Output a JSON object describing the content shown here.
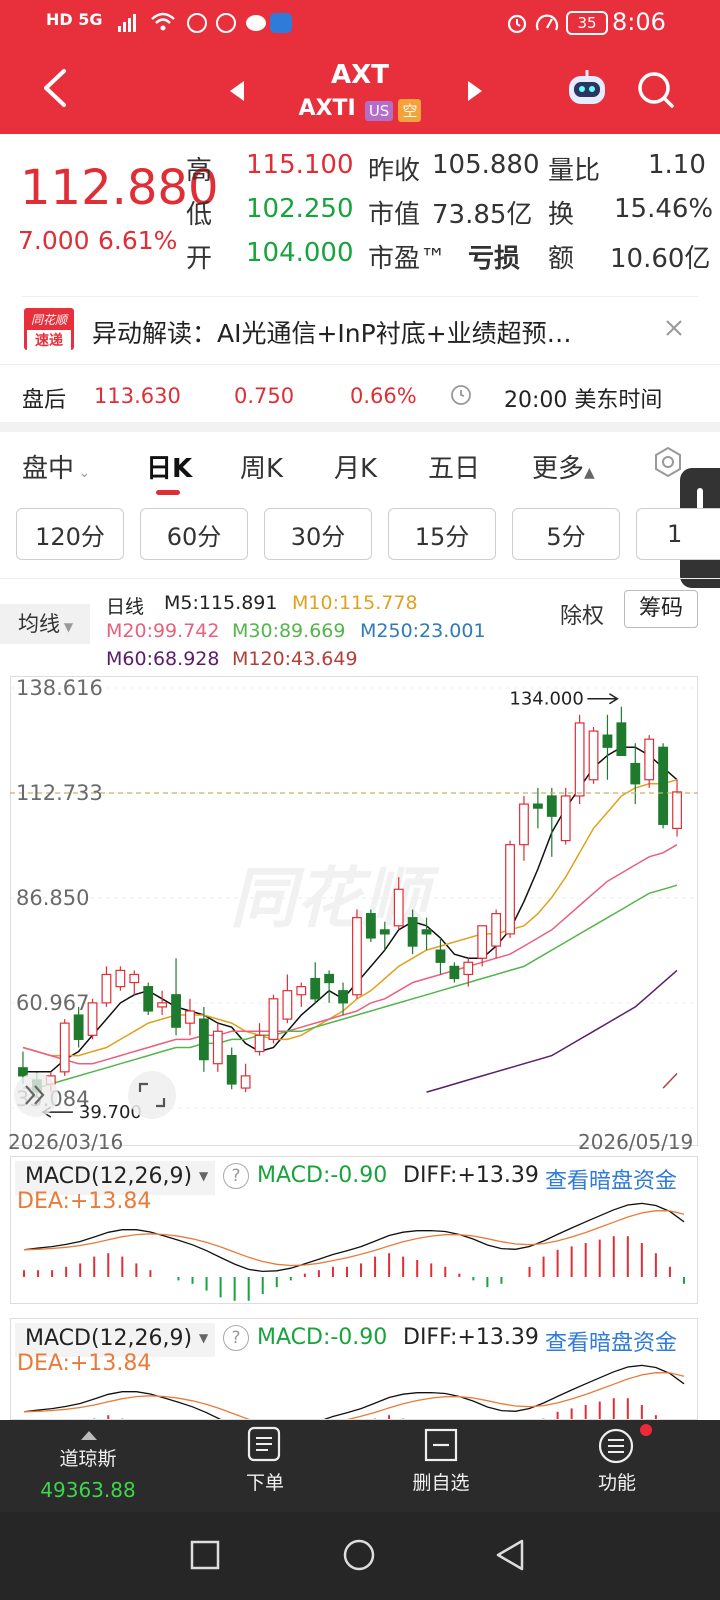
{
  "status_bar": {
    "left_icons": "HD 5G",
    "time": "8:06",
    "battery": "35"
  },
  "header": {
    "ticker": "AXT",
    "symbol": "AXTI",
    "market_badge": "US",
    "short_badge": "空"
  },
  "colors": {
    "up": "#e02e36",
    "down": "#17a43c",
    "brand_red": "#e8303c"
  },
  "quote": {
    "price": "112.880",
    "change": "7.000",
    "change_pct": "6.61%",
    "high_label": "高",
    "high": "115.100",
    "low_label": "低",
    "low": "102.250",
    "open_label": "开",
    "open": "104.000",
    "prev_close_label": "昨收",
    "prev_close": "105.880",
    "mkt_cap_label": "市值",
    "mkt_cap": "73.85亿",
    "pe_label": "市盈™",
    "pe": "亏损",
    "vol_ratio_label": "量比",
    "vol_ratio": "1.10",
    "turnover_label": "换",
    "turnover": "15.46%",
    "amount_label": "额",
    "amount": "10.60亿"
  },
  "news": {
    "logo_top": "同花顺",
    "logo_bottom": "速递",
    "text": "异动解读：AI光通信+InP衬底+业绩超预…"
  },
  "after_hours": {
    "label": "盘后",
    "price": "113.630",
    "change": "0.750",
    "pct": "0.66%",
    "time": "20:00 美东时间"
  },
  "period_tabs": [
    "盘中",
    "日K",
    "周K",
    "月K",
    "五日",
    "更多"
  ],
  "active_tab": "日K",
  "minute_tabs": [
    "120分",
    "60分",
    "30分",
    "15分",
    "5分",
    "1"
  ],
  "ma_legend": {
    "avg_btn": "均线",
    "title": "日线",
    "m5": "M5:115.891",
    "m10": "M10:115.778",
    "m20": "M20:99.742",
    "m30": "M30:89.669",
    "m250": "M250:23.001",
    "m60": "M60:68.928",
    "m120": "M120:43.649",
    "exright": "除权",
    "chips": "筹码"
  },
  "chart_data": {
    "type": "candlestick",
    "y_ticks": [
      "138.616",
      "112.733",
      "86.850",
      "60.967",
      "35.084"
    ],
    "x_start": "2026/03/16",
    "x_end": "2026/05/19",
    "high_annotation": "134.000",
    "low_annotation": "39.700",
    "current_line": 112.733,
    "ylim": [
      35.084,
      138.616
    ],
    "candles": [
      {
        "o": 45,
        "h": 49,
        "l": 41,
        "c": 43
      },
      {
        "o": 42,
        "h": 44,
        "l": 38,
        "c": 39
      },
      {
        "o": 41,
        "h": 44,
        "l": 39,
        "c": 43
      },
      {
        "o": 44,
        "h": 57,
        "l": 43,
        "c": 56
      },
      {
        "o": 58,
        "h": 60,
        "l": 50,
        "c": 52
      },
      {
        "o": 53,
        "h": 62,
        "l": 52,
        "c": 61
      },
      {
        "o": 61,
        "h": 70,
        "l": 60,
        "c": 68
      },
      {
        "o": 65,
        "h": 70,
        "l": 64,
        "c": 69
      },
      {
        "o": 66,
        "h": 69,
        "l": 63,
        "c": 68
      },
      {
        "o": 65,
        "h": 66,
        "l": 58,
        "c": 59
      },
      {
        "o": 60,
        "h": 64,
        "l": 58,
        "c": 61
      },
      {
        "o": 63,
        "h": 72,
        "l": 53,
        "c": 55
      },
      {
        "o": 56,
        "h": 62,
        "l": 53,
        "c": 59
      },
      {
        "o": 57,
        "h": 60,
        "l": 44,
        "c": 47
      },
      {
        "o": 46,
        "h": 56,
        "l": 44,
        "c": 54
      },
      {
        "o": 48,
        "h": 50,
        "l": 39.7,
        "c": 41
      },
      {
        "o": 40,
        "h": 46,
        "l": 39,
        "c": 43
      },
      {
        "o": 49,
        "h": 56,
        "l": 48,
        "c": 53
      },
      {
        "o": 52,
        "h": 63,
        "l": 51,
        "c": 62
      },
      {
        "o": 57,
        "h": 68,
        "l": 56,
        "c": 64
      },
      {
        "o": 63,
        "h": 66,
        "l": 60,
        "c": 65
      },
      {
        "o": 67,
        "h": 71,
        "l": 61,
        "c": 62
      },
      {
        "o": 68,
        "h": 69,
        "l": 61,
        "c": 66
      },
      {
        "o": 64,
        "h": 66,
        "l": 58,
        "c": 61
      },
      {
        "o": 63,
        "h": 84,
        "l": 62,
        "c": 82
      },
      {
        "o": 83,
        "h": 84,
        "l": 76,
        "c": 77
      },
      {
        "o": 79,
        "h": 81,
        "l": 74,
        "c": 78
      },
      {
        "o": 80,
        "h": 92,
        "l": 79,
        "c": 89
      },
      {
        "o": 82,
        "h": 84,
        "l": 73,
        "c": 75
      },
      {
        "o": 79,
        "h": 82,
        "l": 74,
        "c": 78
      },
      {
        "o": 74,
        "h": 77,
        "l": 68,
        "c": 71
      },
      {
        "o": 70,
        "h": 71,
        "l": 66,
        "c": 67
      },
      {
        "o": 68,
        "h": 72,
        "l": 65,
        "c": 71
      },
      {
        "o": 72,
        "h": 80,
        "l": 70,
        "c": 80
      },
      {
        "o": 75,
        "h": 84,
        "l": 72,
        "c": 83
      },
      {
        "o": 78,
        "h": 101,
        "l": 77,
        "c": 100
      },
      {
        "o": 100,
        "h": 112,
        "l": 96,
        "c": 110
      },
      {
        "o": 110,
        "h": 114,
        "l": 104,
        "c": 109
      },
      {
        "o": 112,
        "h": 114,
        "l": 97,
        "c": 107
      },
      {
        "o": 101,
        "h": 114,
        "l": 100,
        "c": 112
      },
      {
        "o": 112,
        "h": 132,
        "l": 110,
        "c": 130
      },
      {
        "o": 116,
        "h": 129,
        "l": 115,
        "c": 128
      },
      {
        "o": 127,
        "h": 132,
        "l": 116,
        "c": 124
      },
      {
        "o": 130,
        "h": 134,
        "l": 122,
        "c": 122
      },
      {
        "o": 120,
        "h": 125,
        "l": 110,
        "c": 115
      },
      {
        "o": 116,
        "h": 127,
        "l": 114,
        "c": 126
      },
      {
        "o": 124,
        "h": 125,
        "l": 104,
        "c": 105
      },
      {
        "o": 104,
        "h": 116,
        "l": 102,
        "c": 113
      }
    ],
    "ma_lines": {
      "M5": [
        44,
        44,
        44,
        47,
        49,
        53,
        57,
        61,
        63,
        64,
        62,
        60,
        59,
        58,
        56,
        55,
        51,
        49,
        50,
        54,
        58,
        61,
        64,
        62,
        66,
        70,
        74,
        79,
        81,
        80,
        77,
        73,
        72,
        72,
        75,
        79,
        86,
        94,
        103,
        109,
        114,
        119,
        122,
        124,
        124,
        122,
        119,
        116
      ],
      "M10": [
        50,
        49,
        48,
        48,
        48,
        49,
        50,
        52,
        54,
        56,
        57,
        58,
        58,
        58,
        57,
        56,
        54,
        53,
        52,
        52,
        53,
        55,
        57,
        59,
        62,
        64,
        67,
        70,
        72,
        74,
        75,
        76,
        77,
        78,
        78,
        79,
        80,
        83,
        87,
        92,
        98,
        104,
        108,
        112,
        114,
        115,
        115,
        116
      ],
      "M20": [
        50,
        49,
        48,
        47,
        46,
        46,
        47,
        48,
        49,
        50,
        51,
        52,
        52,
        53,
        53,
        54,
        54,
        54,
        54,
        54,
        55,
        56,
        57,
        58,
        59,
        61,
        62,
        64,
        66,
        67,
        68,
        69,
        70,
        71,
        72,
        73,
        75,
        77,
        79,
        82,
        85,
        88,
        91,
        93,
        95,
        97,
        98,
        100
      ],
      "M30": [
        40,
        40,
        41,
        42,
        43,
        44,
        45,
        46,
        47,
        48,
        49,
        50,
        50,
        51,
        51,
        52,
        52,
        53,
        53,
        54,
        54,
        55,
        56,
        57,
        58,
        59,
        60,
        61,
        62,
        63,
        64,
        65,
        66,
        67,
        68,
        69,
        70,
        72,
        74,
        76,
        78,
        80,
        82,
        84,
        86,
        88,
        89,
        90
      ],
      "M60": [
        null,
        null,
        null,
        null,
        null,
        null,
        null,
        null,
        null,
        null,
        null,
        null,
        null,
        null,
        null,
        null,
        null,
        null,
        null,
        null,
        null,
        null,
        null,
        null,
        null,
        null,
        null,
        null,
        null,
        39,
        40,
        41,
        42,
        43,
        44,
        45,
        46,
        47,
        48,
        50,
        52,
        54,
        56,
        58,
        60,
        63,
        66,
        69
      ],
      "M120": [
        null,
        null,
        null,
        null,
        null,
        null,
        null,
        null,
        null,
        null,
        null,
        null,
        null,
        null,
        null,
        null,
        null,
        null,
        null,
        null,
        null,
        null,
        null,
        null,
        null,
        null,
        null,
        null,
        null,
        null,
        null,
        null,
        null,
        null,
        null,
        null,
        null,
        null,
        null,
        null,
        null,
        null,
        null,
        null,
        null,
        null,
        40,
        43.6
      ]
    }
  },
  "macd_panel_1": {
    "title": "MACD(12,26,9)",
    "help": "?",
    "macd": "MACD:-0.90",
    "diff": "DIFF:+13.39",
    "link": "查看暗盘资金",
    "dea": "DEA:+13.84"
  },
  "macd_panel_2": {
    "title": "MACD(12,26,9)",
    "help": "?",
    "macd": "MACD:-0.90",
    "diff": "DIFF:+13.39",
    "link": "查看暗盘资金",
    "dea": "DEA:+13.84"
  },
  "macd_hist": [
    2,
    2,
    2,
    3,
    4,
    6,
    7,
    6,
    4,
    2,
    0,
    -1,
    -2,
    -4,
    -6,
    -7,
    -7,
    -5,
    -3,
    -1,
    1,
    2,
    3,
    3,
    4,
    6,
    7,
    6,
    5,
    4,
    3,
    1,
    -1,
    -3,
    -2,
    0,
    3,
    6,
    8,
    9,
    10,
    11,
    12,
    12,
    10,
    7,
    3,
    -2
  ],
  "bottom_bar": {
    "index_name": "道琼斯",
    "index_value": "49363.88",
    "order_label": "下单",
    "remove_label": "删自选",
    "func_label": "功能"
  }
}
